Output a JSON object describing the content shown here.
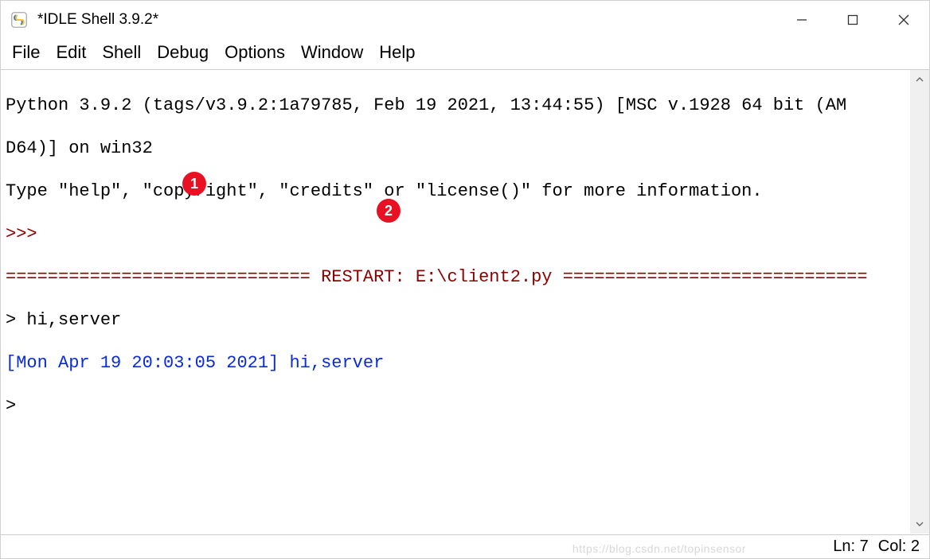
{
  "window": {
    "title": "*IDLE Shell 3.9.2*"
  },
  "menubar": {
    "items": [
      "File",
      "Edit",
      "Shell",
      "Debug",
      "Options",
      "Window",
      "Help"
    ]
  },
  "shell": {
    "banner_line1": "Python 3.9.2 (tags/v3.9.2:1a79785, Feb 19 2021, 13:44:55) [MSC v.1928 64 bit (AM",
    "banner_line2": "D64)] on win32",
    "banner_line3": "Type \"help\", \"copyright\", \"credits\" or \"license()\" for more information.",
    "prompt1": ">>> ",
    "restart_line": "============================= RESTART: E:\\client2.py =============================",
    "input_line": "> hi,server",
    "echo_line": "[Mon Apr 19 20:03:05 2021] hi,server",
    "prompt2": "> "
  },
  "annotations": {
    "a1": "1",
    "a2": "2"
  },
  "status": {
    "line": "Ln: 7",
    "col": "Col: 2"
  },
  "watermark": "https://blog.csdn.net/topinsensor"
}
